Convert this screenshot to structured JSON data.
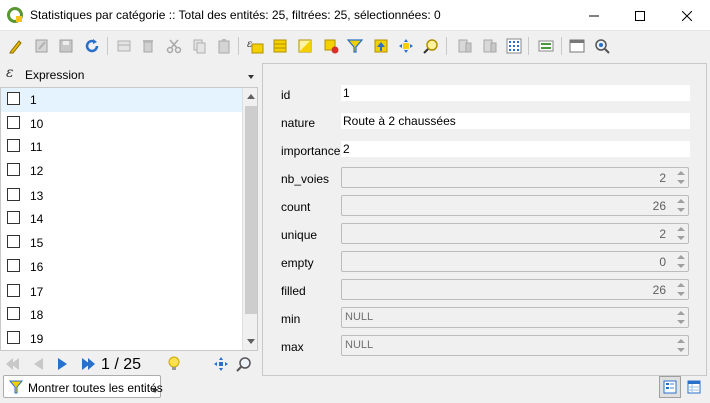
{
  "window": {
    "title": "Statistiques par catégorie :: Total des entités: 25, filtrées: 25, sélectionnées: 0",
    "icon": "qgis-icon",
    "controls": [
      "minimize-icon",
      "maximize-icon",
      "close-icon"
    ]
  },
  "toolbar": {
    "icons": [
      "edit-pencil-icon",
      "multi-edit-icon",
      "save-icon",
      "reload-icon",
      "add-feature-icon",
      "delete-feature-icon",
      "cut-icon",
      "copy-icon",
      "paste-icon",
      "expression-select-icon",
      "select-all-icon",
      "invert-selection-icon",
      "deselect-icon",
      "filter-select-icon",
      "move-selection-top-icon",
      "pan-to-selection-icon",
      "zoom-to-selection-icon",
      "new-field-icon",
      "delete-field-icon",
      "field-calculator-icon",
      "conditional-format-icon",
      "dock-icon",
      "actions-icon"
    ]
  },
  "expression": {
    "icon": "expression-icon",
    "label": "Expression"
  },
  "list": {
    "items": [
      {
        "label": "1",
        "selected": true
      },
      {
        "label": "10",
        "selected": false
      },
      {
        "label": "11",
        "selected": false
      },
      {
        "label": "12",
        "selected": false
      },
      {
        "label": "13",
        "selected": false
      },
      {
        "label": "14",
        "selected": false
      },
      {
        "label": "15",
        "selected": false
      },
      {
        "label": "16",
        "selected": false
      },
      {
        "label": "17",
        "selected": false
      },
      {
        "label": "18",
        "selected": false
      },
      {
        "label": "19",
        "selected": false
      }
    ]
  },
  "navigation": {
    "counter": "1 / 25",
    "icons": [
      "first-icon",
      "previous-icon",
      "next-icon",
      "last-icon",
      "highlight-icon",
      "pan-icon",
      "zoom-icon"
    ]
  },
  "filter": {
    "label": "Montrer toutes les entités"
  },
  "form": {
    "fields": [
      {
        "label": "id",
        "value": "1",
        "kind": "text"
      },
      {
        "label": "nature",
        "value": "Route à 2 chaussées",
        "kind": "text"
      },
      {
        "label": "importance",
        "value": "2",
        "kind": "text"
      },
      {
        "label": "nb_voies",
        "value": "2",
        "kind": "spin"
      },
      {
        "label": "count",
        "value": "26",
        "kind": "spin"
      },
      {
        "label": "unique",
        "value": "2",
        "kind": "spin"
      },
      {
        "label": "empty",
        "value": "0",
        "kind": "spin"
      },
      {
        "label": "filled",
        "value": "26",
        "kind": "spin"
      },
      {
        "label": "min",
        "value": "NULL",
        "kind": "spin"
      },
      {
        "label": "max",
        "value": "NULL",
        "kind": "spin"
      }
    ]
  },
  "view_toggle": {
    "icons": [
      "form-view-icon",
      "table-view-icon"
    ],
    "active": "form-view-icon"
  }
}
